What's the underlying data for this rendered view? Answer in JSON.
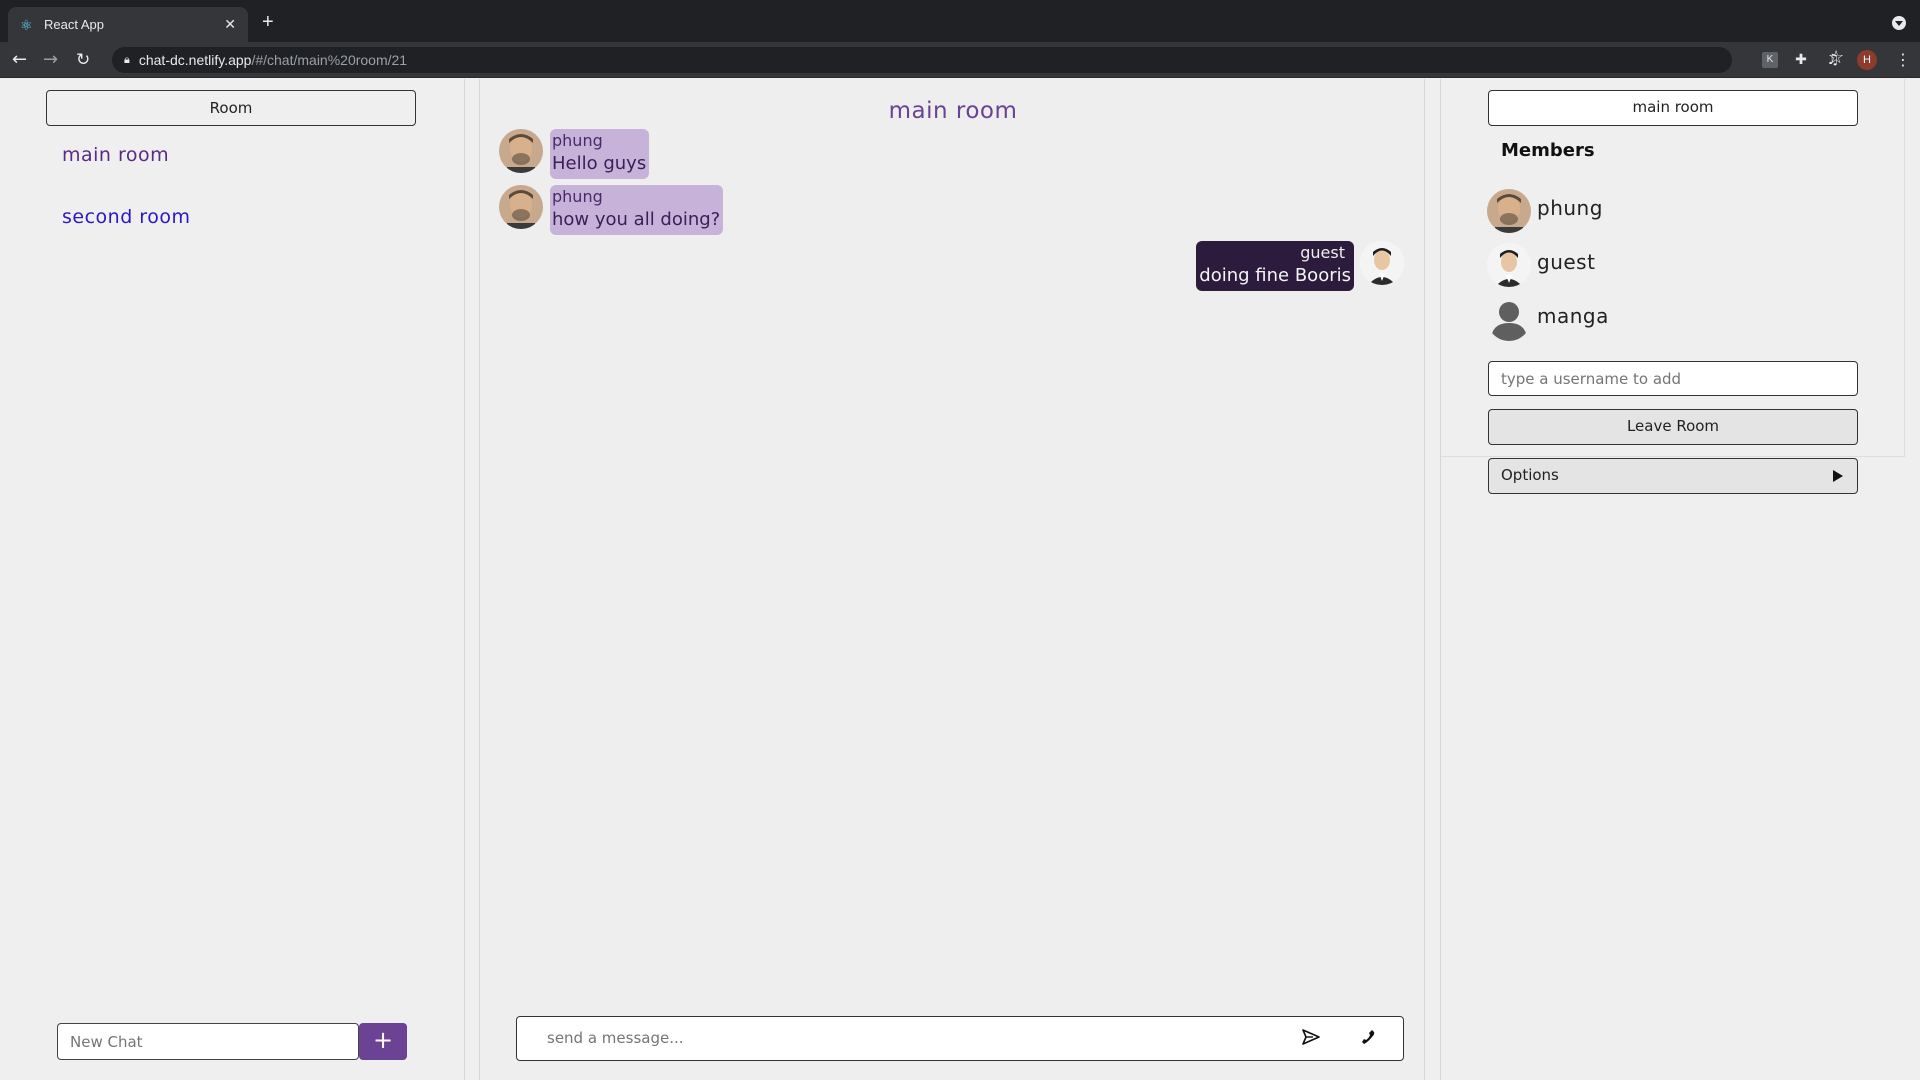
{
  "browser": {
    "tab_title": "React App",
    "url_host": "chat-dc.netlify.app",
    "url_path": "/#/chat/main%20room/21",
    "profile_initial": "H"
  },
  "left": {
    "header": "Room",
    "rooms": [
      {
        "label": "main room",
        "active": true
      },
      {
        "label": "second room",
        "active": false
      }
    ],
    "new_chat_placeholder": "New Chat",
    "add_label": "+"
  },
  "chat": {
    "title": "main room",
    "messages": [
      {
        "sender": "phung",
        "text": "Hello guys",
        "direction": "in"
      },
      {
        "sender": "phung",
        "text": "how you all doing?",
        "direction": "in"
      },
      {
        "sender": "guest",
        "text": "doing fine Booris",
        "direction": "out"
      }
    ],
    "composer_placeholder": "send a message..."
  },
  "right": {
    "room_name": "main room",
    "members_title": "Members",
    "members": [
      {
        "name": "phung"
      },
      {
        "name": "guest"
      },
      {
        "name": "manga"
      }
    ],
    "add_user_placeholder": "type a username to add",
    "leave_label": "Leave Room",
    "options_label": "Options"
  },
  "colors": {
    "accent": "#6c4294",
    "incoming_bubble": "#c7b3d9",
    "outgoing_bubble": "#2d1b3d",
    "active_room": "#5b2a86",
    "link_room": "#2a17c9"
  }
}
